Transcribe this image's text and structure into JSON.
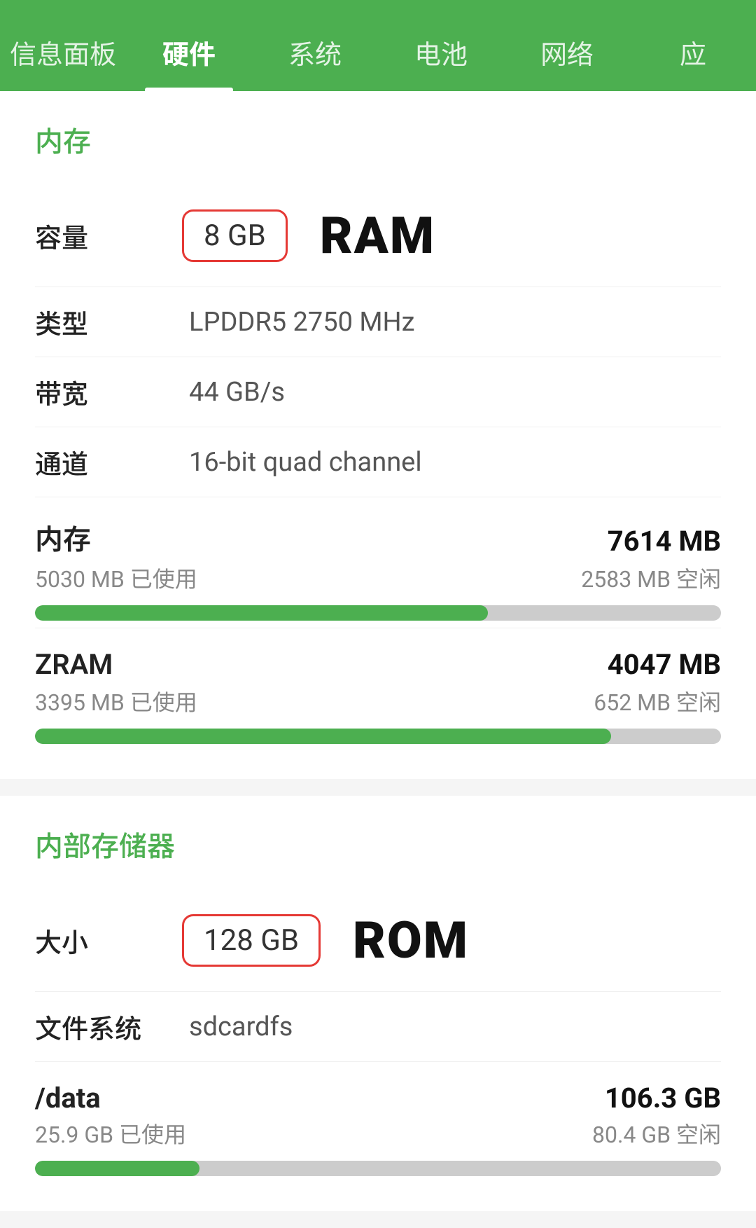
{
  "nav": {
    "items": [
      {
        "id": "info-panel",
        "label": "信息面板",
        "active": false
      },
      {
        "id": "hardware",
        "label": "硬件",
        "active": true
      },
      {
        "id": "system",
        "label": "系统",
        "active": false
      },
      {
        "id": "battery",
        "label": "电池",
        "active": false
      },
      {
        "id": "network",
        "label": "网络",
        "active": false
      },
      {
        "id": "apps",
        "label": "应",
        "active": false
      }
    ]
  },
  "memory_section": {
    "title": "内存",
    "capacity": {
      "label": "容量",
      "badge": "8 GB",
      "type": "RAM"
    },
    "type_row": {
      "label": "类型",
      "value": "LPDDR5 2750 MHz"
    },
    "bandwidth_row": {
      "label": "带宽",
      "value": "44 GB/s"
    },
    "channel_row": {
      "label": "通道",
      "value": "16-bit quad channel"
    },
    "ram_bar": {
      "title": "内存",
      "total": "7614 MB",
      "used": "5030 MB 已使用",
      "free": "2583 MB 空闲",
      "fill_percent": 66
    },
    "zram_bar": {
      "title": "ZRAM",
      "total": "4047 MB",
      "used": "3395 MB 已使用",
      "free": "652 MB 空闲",
      "fill_percent": 84
    }
  },
  "storage_section": {
    "title": "内部存储器",
    "capacity": {
      "label": "大小",
      "badge": "128 GB",
      "type": "ROM"
    },
    "filesystem_row": {
      "label": "文件系统",
      "value": "sdcardfs"
    },
    "data_bar": {
      "title": "/data",
      "total": "106.3 GB",
      "used": "25.9 GB 已使用",
      "free": "80.4 GB 空闲",
      "fill_percent": 24
    }
  }
}
